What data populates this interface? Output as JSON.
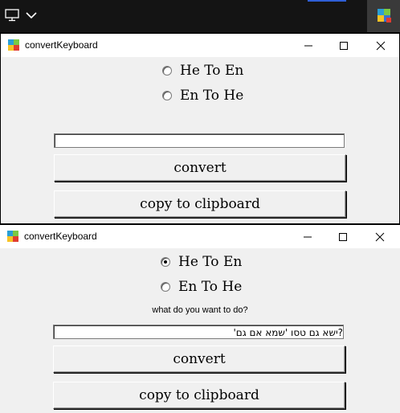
{
  "taskbar": {
    "icons": [
      "monitor-icon",
      "chevron-down-icon",
      "app-icon"
    ]
  },
  "window1": {
    "title": "convertKeyboard",
    "radio_options": [
      {
        "label": "He To En",
        "checked": false
      },
      {
        "label": "En To He",
        "checked": false
      }
    ],
    "prompt": "",
    "input_value": "",
    "convert_label": "convert",
    "copy_label": "copy to clipboard"
  },
  "window2": {
    "title": "convertKeyboard",
    "radio_options": [
      {
        "label": "He To En",
        "checked": true
      },
      {
        "label": "En To He",
        "checked": false
      }
    ],
    "prompt": "what do you want to do?",
    "input_value": "?ישא גם טסו 'שמא אם גם'",
    "convert_label": "convert",
    "copy_label": "copy to clipboard"
  },
  "colors": {
    "window_bg": "#f0f0f0",
    "titlebar_bg": "#ffffff",
    "taskbar_bg": "#141414",
    "accent": "#2f5fd6"
  }
}
